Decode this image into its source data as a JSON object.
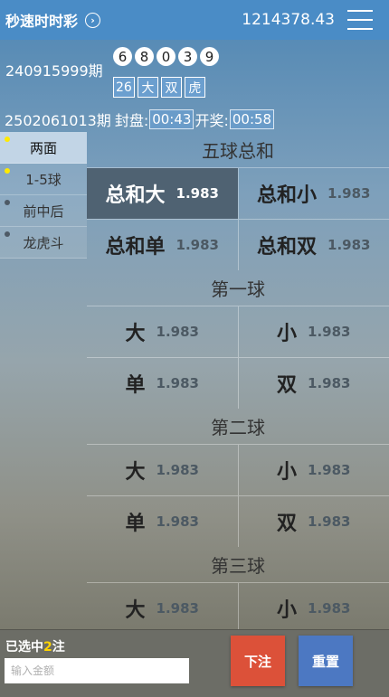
{
  "header": {
    "title": "秒速时时彩",
    "arrow_glyph": "›",
    "balance": "1214378.43"
  },
  "last_draw": {
    "period": "240915999期",
    "balls": [
      "6",
      "8",
      "0",
      "3",
      "9"
    ],
    "tags": [
      "26",
      "大",
      "双",
      "虎"
    ]
  },
  "current": {
    "period": "2502061013期",
    "close_label": "封盘:",
    "close_time": "00:43",
    "open_label": "开奖:",
    "open_time": "00:58"
  },
  "sidebar": {
    "items": [
      {
        "label": "两面",
        "dot_active": true,
        "active": true
      },
      {
        "label": "1-5球",
        "dot_active": true,
        "active": false
      },
      {
        "label": "前中后",
        "dot_active": false,
        "active": false
      },
      {
        "label": "龙虎斗",
        "dot_active": false,
        "active": false
      }
    ]
  },
  "sections": [
    {
      "title": "五球总和",
      "rows": [
        [
          {
            "name": "总和大",
            "odds": "1.983",
            "selected": true
          },
          {
            "name": "总和小",
            "odds": "1.983",
            "selected": false
          }
        ],
        [
          {
            "name": "总和单",
            "odds": "1.983",
            "selected": false
          },
          {
            "name": "总和双",
            "odds": "1.983",
            "selected": false
          }
        ]
      ]
    },
    {
      "title": "第一球",
      "rows": [
        [
          {
            "name": "大",
            "odds": "1.983",
            "selected": false
          },
          {
            "name": "小",
            "odds": "1.983",
            "selected": false
          }
        ],
        [
          {
            "name": "单",
            "odds": "1.983",
            "selected": false
          },
          {
            "name": "双",
            "odds": "1.983",
            "selected": false
          }
        ]
      ]
    },
    {
      "title": "第二球",
      "rows": [
        [
          {
            "name": "大",
            "odds": "1.983",
            "selected": false
          },
          {
            "name": "小",
            "odds": "1.983",
            "selected": false
          }
        ],
        [
          {
            "name": "单",
            "odds": "1.983",
            "selected": false
          },
          {
            "name": "双",
            "odds": "1.983",
            "selected": false
          }
        ]
      ]
    },
    {
      "title": "第三球",
      "rows": [
        [
          {
            "name": "大",
            "odds": "1.983",
            "selected": false
          },
          {
            "name": "小",
            "odds": "1.983",
            "selected": false
          }
        ]
      ]
    }
  ],
  "footer": {
    "selected_prefix": "已选中",
    "selected_count": "2",
    "selected_suffix": "注",
    "amount_placeholder": "输入金额",
    "submit_label": "下注",
    "reset_label": "重置"
  },
  "colors": {
    "header": "#4a8cc6",
    "selected_cell": "#4f6272",
    "submit": "#dc5139",
    "reset": "#4c78c2",
    "count_highlight": "#ffd400"
  }
}
